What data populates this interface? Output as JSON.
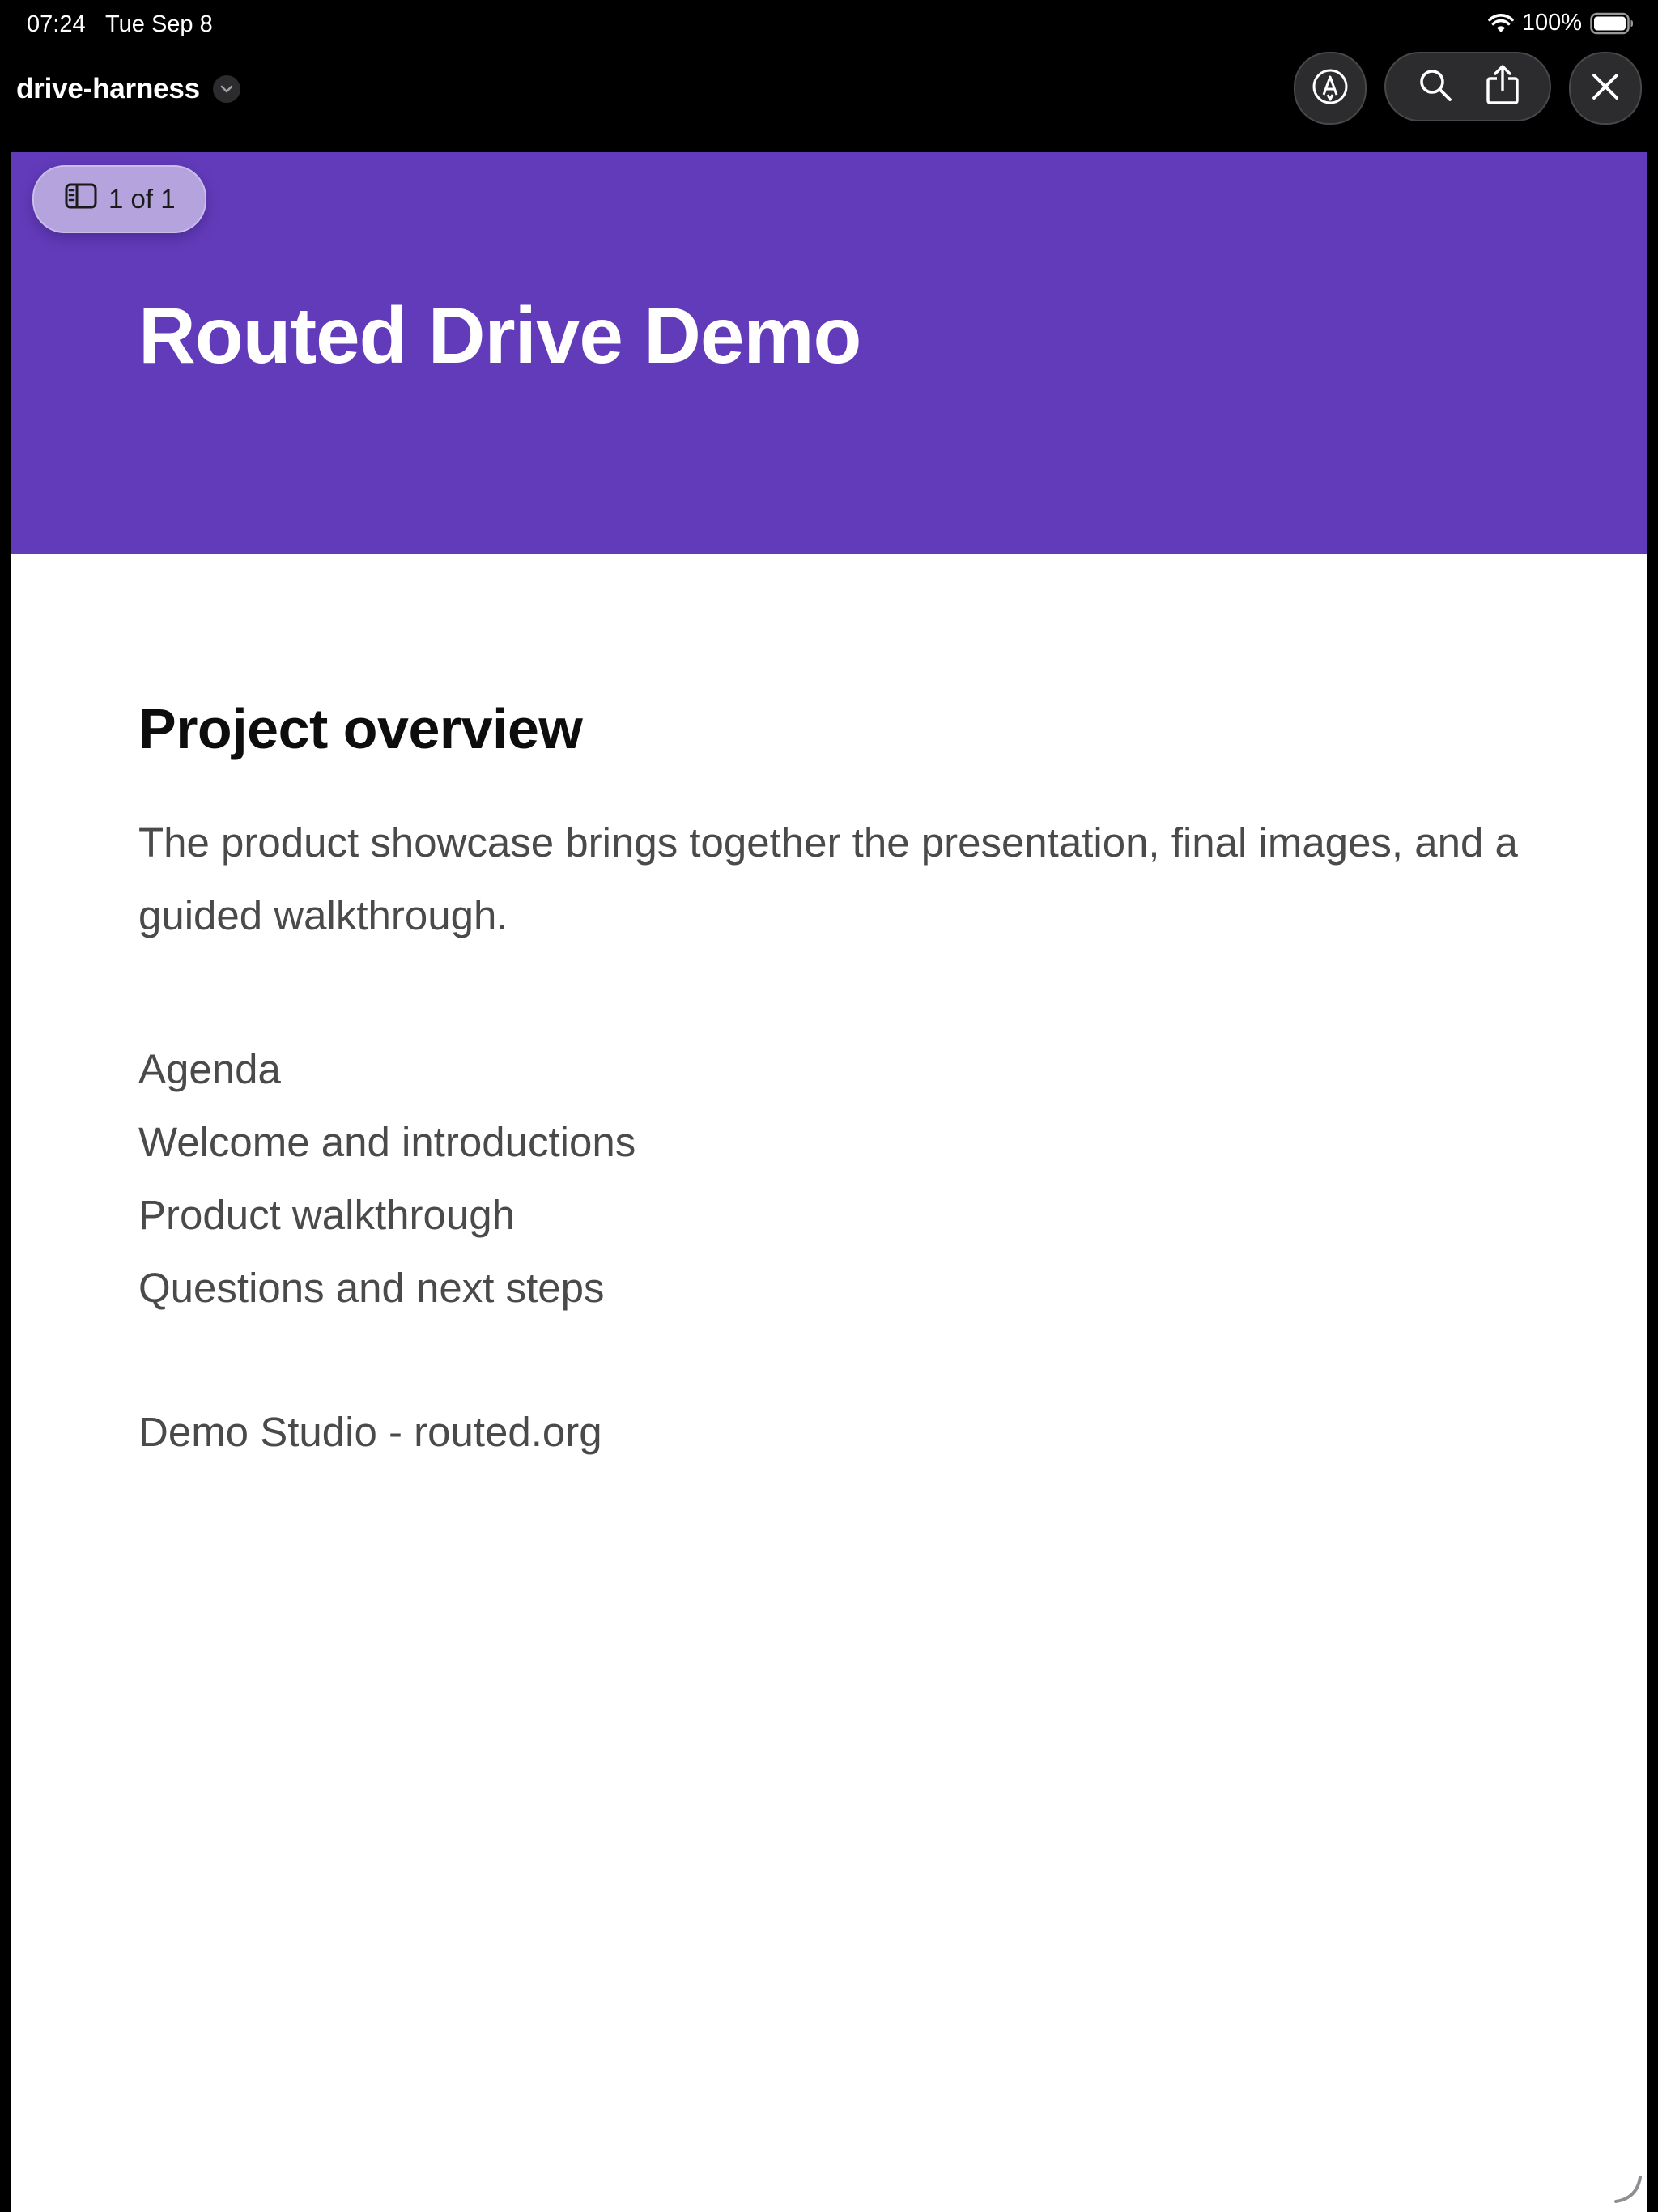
{
  "status_bar": {
    "time": "07:24",
    "date": "Tue Sep 8",
    "battery": "100%"
  },
  "toolbar": {
    "document_title": "drive-harness",
    "icons": [
      "chevron-down-icon",
      "markup-icon",
      "search-icon",
      "share-icon",
      "close-icon"
    ]
  },
  "page": {
    "page_indicator": "1 of 1",
    "banner_title": "Routed Drive Demo",
    "section_heading": "Project overview",
    "paragraph": "The product showcase brings together the presentation, final images, and a guided walkthrough.",
    "agenda": [
      "Agenda",
      "Welcome and introductions",
      "Product walkthrough",
      "Questions and next steps"
    ],
    "footer": "Demo Studio - routed.org"
  },
  "colors": {
    "banner": "#623bba",
    "page_background": "#ffffff",
    "body_text": "#4a4a4a",
    "toolbar_background": "#000000"
  }
}
